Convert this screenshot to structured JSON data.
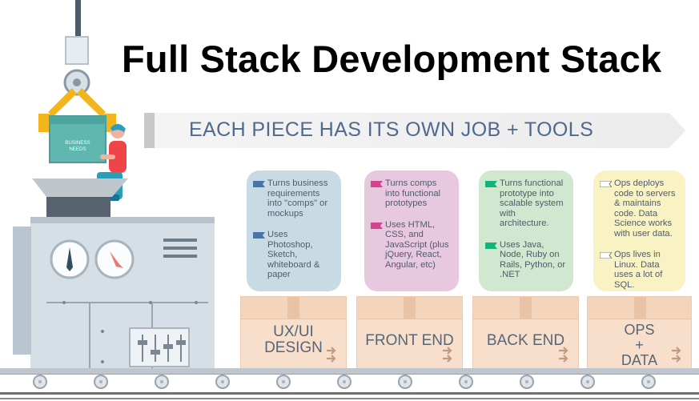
{
  "title": "Full Stack Development Stack",
  "banner": {
    "text": "EACH PIECE HAS ITS OWN JOB + TOOLS"
  },
  "machine": {
    "box_label": "BUSINESS\nNEEDS"
  },
  "stages": [
    {
      "box_label": "UX/UI\nDESIGN",
      "flag_color": "#4a74a8",
      "card_bg": "#c8dbe4",
      "items": [
        "Turns business requirements into \"comps\" or mockups",
        "Uses Photoshop, Sketch, whiteboard & paper"
      ]
    },
    {
      "box_label": "FRONT END",
      "flag_color": "#d5438e",
      "card_bg": "#e8c8df",
      "items": [
        "Turns comps into functional prototypes",
        "Uses HTML, CSS, and JavaScript (plus jQuery, React, Angular, etc)"
      ]
    },
    {
      "box_label": "BACK END",
      "flag_color": "#13b47b",
      "card_bg": "#cfe8cf",
      "items": [
        "Turns functional prototype into scalable system with architecture.",
        "Uses Java, Node, Ruby on Rails, Python, or .NET"
      ]
    },
    {
      "box_label": "OPS\n+\nDATA",
      "flag_color": "#ffffff",
      "card_bg": "#f9f3c3",
      "items": [
        "Ops deploys code to servers & maintains code. Data Science works with user data.",
        "Ops lives in Linux. Data uses a lot of SQL."
      ]
    }
  ]
}
